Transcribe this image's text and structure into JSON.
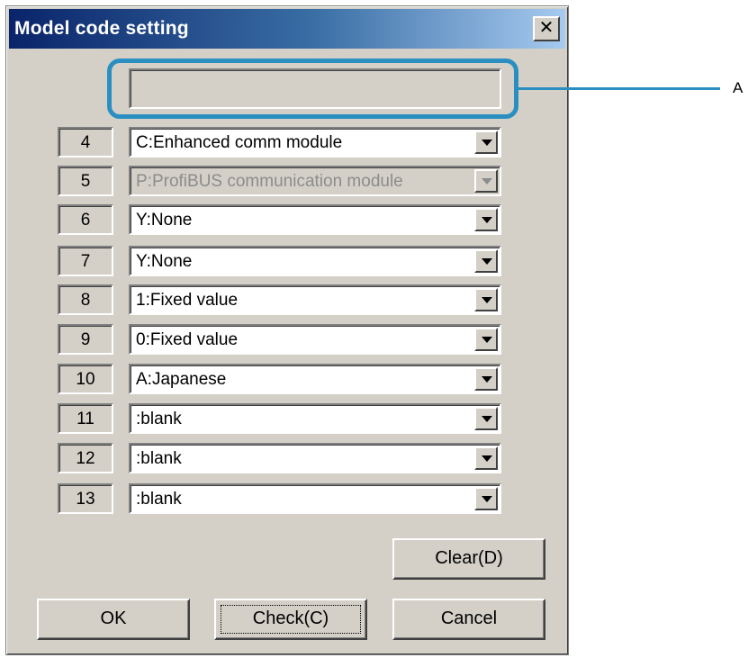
{
  "window": {
    "title": "Model code setting",
    "close_glyph": "✕"
  },
  "code_display": {
    "value": ""
  },
  "callout": {
    "label": "A"
  },
  "rows": [
    {
      "num": "4",
      "value": "C:Enhanced comm module",
      "enabled": true
    },
    {
      "num": "5",
      "value": "P:ProfiBUS communication module",
      "enabled": false
    },
    {
      "num": "6",
      "value": "Y:None",
      "enabled": true
    },
    {
      "num": "7",
      "value": "Y:None",
      "enabled": true
    },
    {
      "num": "8",
      "value": "1:Fixed value",
      "enabled": true
    },
    {
      "num": "9",
      "value": "0:Fixed value",
      "enabled": true
    },
    {
      "num": "10",
      "value": "A:Japanese",
      "enabled": true
    },
    {
      "num": "11",
      "value": ":blank",
      "enabled": true
    },
    {
      "num": "12",
      "value": ":blank",
      "enabled": true
    },
    {
      "num": "13",
      "value": ":blank",
      "enabled": true
    }
  ],
  "buttons": {
    "clear": "Clear(D)",
    "ok": "OK",
    "check": "Check(C)",
    "cancel": "Cancel"
  }
}
